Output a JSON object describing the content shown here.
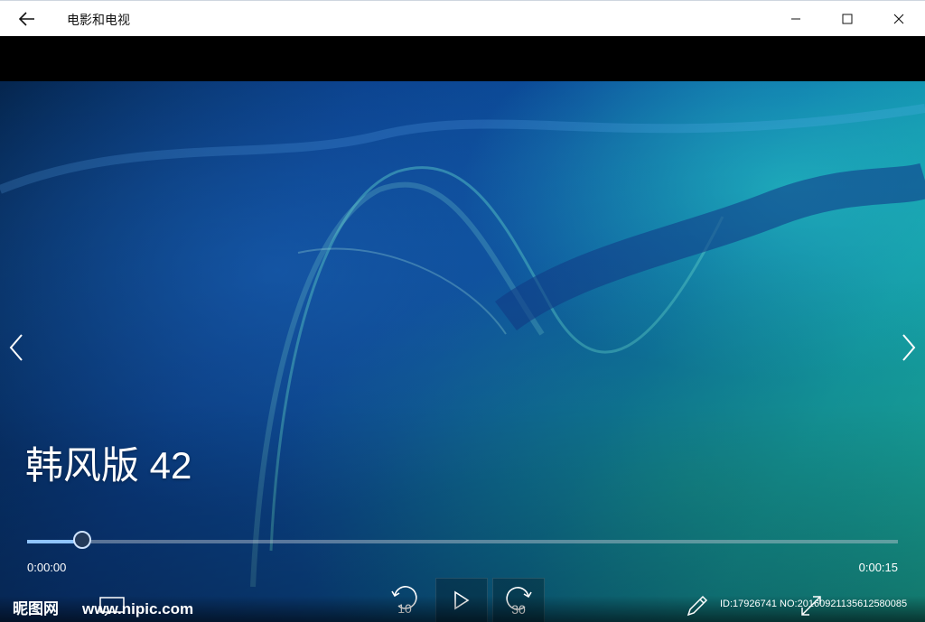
{
  "window": {
    "title": "电影和电视"
  },
  "photo": {
    "title": "韩风版 42"
  },
  "playback": {
    "current_time": "0:00:00",
    "duration": "0:00:15",
    "progress_fraction": 0.063,
    "skip_back_seconds": "10",
    "skip_forward_seconds": "30"
  },
  "watermark": {
    "brand": "昵图网",
    "site": "www.nipic.com",
    "id_text": "ID:17926741 NO:20160921135612580085"
  },
  "icons": {
    "back": "back-arrow-icon",
    "minimize": "minimize-icon",
    "maximize": "maximize-icon",
    "close": "close-icon",
    "prev": "chevron-left-icon",
    "next": "chevron-right-icon",
    "skip_back": "skip-back-icon",
    "play": "play-icon",
    "skip_forward": "skip-forward-icon",
    "edit": "pencil-icon",
    "fullscreen": "fullscreen-icon",
    "captions": "captions-icon"
  },
  "colors": {
    "accent": "#8fc4ff",
    "titlebar_bg": "#ffffff"
  }
}
